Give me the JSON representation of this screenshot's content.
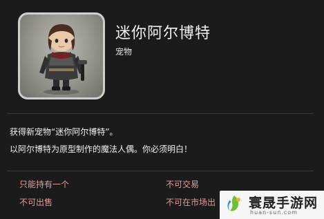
{
  "item": {
    "name": "迷你阿尔博特",
    "type": "宠物",
    "description_line1": "获得新宠物“迷你阿尔博特”。",
    "description_line2": "以阿尔博特为原型制作的魔法人偶。你必须明白！"
  },
  "properties": [
    "只能持有一个",
    "不可交易",
    "不可出售",
    "不可在市场出"
  ],
  "watermark": {
    "title": "寰晟手游网",
    "subtitle": "huan-sun.com"
  },
  "colors": {
    "background": "#1b1b1b",
    "property_text": "#e59a9a",
    "frame_border": "#cfcfcf"
  }
}
